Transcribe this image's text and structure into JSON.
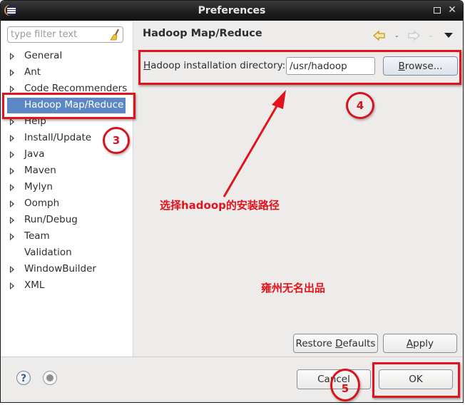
{
  "window": {
    "title": "Preferences",
    "icons": {
      "app": "eclipse-icon",
      "maximize": "maximize-icon",
      "close": "close-icon"
    }
  },
  "sidebar": {
    "filter_placeholder": "type filter text",
    "clear_icon": "broom-icon",
    "items": [
      {
        "label": "General",
        "expandable": true
      },
      {
        "label": "Ant",
        "expandable": true
      },
      {
        "label": "Code Recommenders",
        "expandable": true
      },
      {
        "label": "Hadoop Map/Reduce",
        "expandable": false,
        "selected": true
      },
      {
        "label": "Help",
        "expandable": true
      },
      {
        "label": "Install/Update",
        "expandable": true
      },
      {
        "label": "Java",
        "expandable": true
      },
      {
        "label": "Maven",
        "expandable": true
      },
      {
        "label": "Mylyn",
        "expandable": true
      },
      {
        "label": "Oomph",
        "expandable": true
      },
      {
        "label": "Run/Debug",
        "expandable": true
      },
      {
        "label": "Team",
        "expandable": true
      },
      {
        "label": "Validation",
        "expandable": false
      },
      {
        "label": "WindowBuilder",
        "expandable": true
      },
      {
        "label": "XML",
        "expandable": true
      }
    ]
  },
  "content": {
    "title": "Hadoop Map/Reduce",
    "nav": {
      "back": "back-arrow-icon",
      "back_menu": "⌄",
      "forward": "forward-arrow-icon",
      "forward_menu": "⌄",
      "view_menu": "view-menu-icon"
    },
    "field_label_mnemonic": "H",
    "field_label_rest": "adoop installation directory:",
    "directory_value": "/usr/hadoop",
    "browse_mnemonic": "B",
    "browse_rest": "rowse...",
    "restore_prefix": "Restore ",
    "restore_mnemonic": "D",
    "restore_rest": "efaults",
    "apply_mnemonic": "A",
    "apply_rest": "pply"
  },
  "bottom": {
    "help_icon": "help-icon",
    "record_icon": "record-macro-icon",
    "cancel_label": "Cancel",
    "ok_label": "OK"
  },
  "annotations": {
    "step3": "3",
    "step4": "4",
    "step5": "5",
    "hint": "选择hadoop的安装路径",
    "watermark": "雍州无名出品",
    "color": "#e3131b"
  }
}
